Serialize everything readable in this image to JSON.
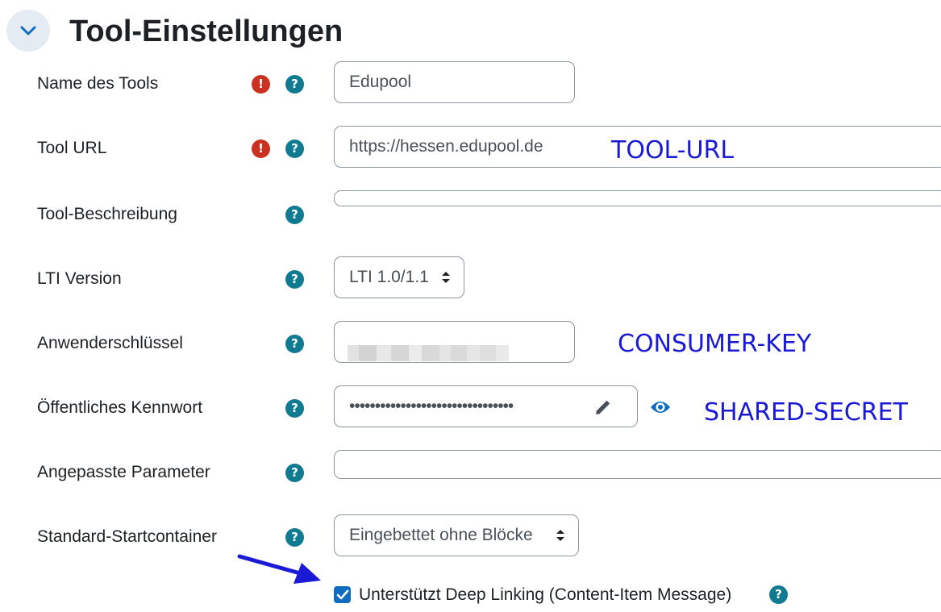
{
  "section": {
    "title": "Tool-Einstellungen",
    "collapse_icon": "chevron-down-icon"
  },
  "fields": {
    "tool_name": {
      "label": "Name des Tools",
      "value": "Edupool"
    },
    "tool_url": {
      "label": "Tool URL",
      "value": "https://hessen.edupool.de"
    },
    "tool_description": {
      "label": "Tool-Beschreibung",
      "value": ""
    },
    "lti_version": {
      "label": "LTI Version",
      "value": "LTI 1.0/1.1"
    },
    "consumer_key": {
      "label": "Anwenderschlüssel",
      "value": ""
    },
    "shared_secret": {
      "label": "Öffentliches Kennwort",
      "value": "••••••••••••••••••••••••••••••••"
    },
    "custom_parameters": {
      "label": "Angepasste Parameter",
      "value": ""
    },
    "launch_container": {
      "label": "Standard-Startcontainer",
      "value": "Eingebettet ohne Blöcke"
    }
  },
  "deep_linking": {
    "label": "Unterstützt Deep Linking (Content-Item Message)",
    "checked": true
  },
  "annotations": {
    "tool_url": "TOOL-URL",
    "consumer_key": "CONSUMER-KEY",
    "shared_secret": "SHARED-SECRET"
  },
  "icons": {
    "required": "!",
    "help": "?"
  },
  "colors": {
    "required": "#ca3120",
    "help": "#0f7a90",
    "annotation": "#1a1ad6",
    "accent": "#0f6cbf"
  }
}
